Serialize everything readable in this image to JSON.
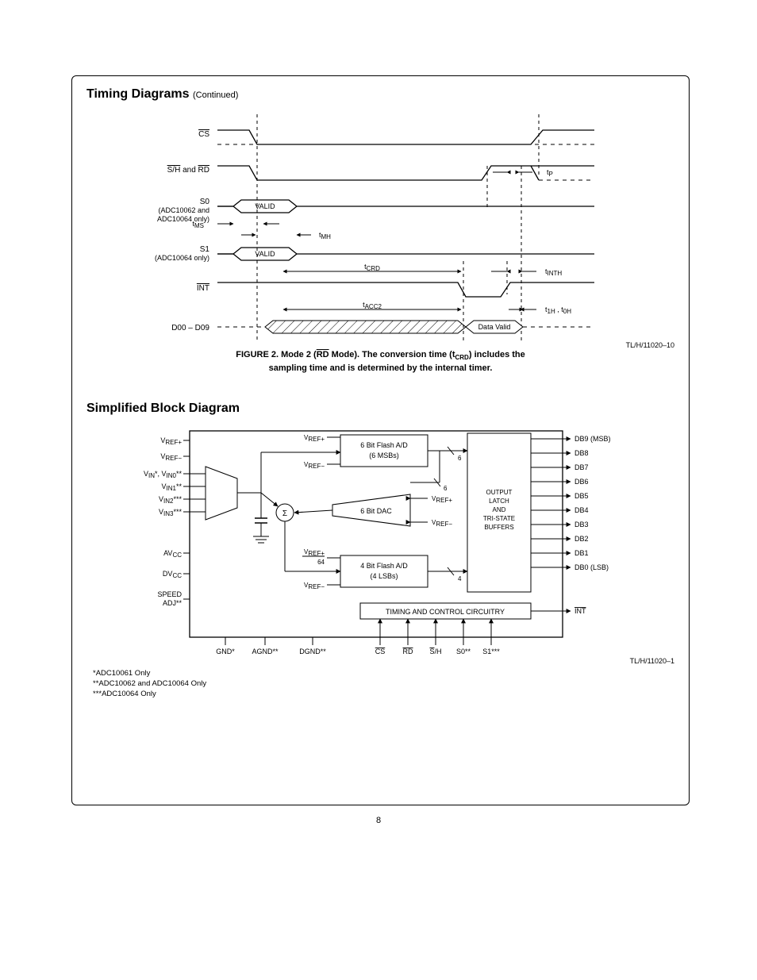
{
  "page_number": "8",
  "timing": {
    "header_main": "Timing Diagrams",
    "header_cont": "(Continued)",
    "signals": {
      "cs": "CS",
      "sh_and_rd_pre": "S/H",
      "sh_and_rd_mid": " and ",
      "sh_and_rd_post": "RD",
      "s0_line1": "S0",
      "s0_line2": "(ADC10062 and",
      "s0_line3": "ADC10064 only)",
      "s1_line1": "S1",
      "s1_line2": "(ADC10064 only)",
      "int": "INT",
      "data": "D00 – D09"
    },
    "markers": {
      "valid": "VALID",
      "tp": "tP",
      "tms": "tMS",
      "tmh": "tMH",
      "tcrd": "tCRD",
      "tinth": "tINTH",
      "tacc2": "tACC2",
      "t1h_t0h": "t1H , t0H",
      "data_valid": "Data Valid"
    },
    "tl_id": "TL/H/11020–10",
    "caption_l1_a": "FIGURE 2. Mode 2 (",
    "caption_l1_b": "RD",
    "caption_l1_c": " Mode). The conversion time (t",
    "caption_l1_d": "CRD",
    "caption_l1_e": ") includes the",
    "caption_l2": "sampling time and is determined by the internal timer."
  },
  "block": {
    "header": "Simplified Block Diagram",
    "left_pins": {
      "vrefp": "VREF+",
      "vrefm": "VREF−",
      "vin": "VIN*, VIN0**",
      "vin1": "VIN1**",
      "vin2": "VIN2***",
      "vin3": "VIN3***",
      "avcc": "AVCC",
      "dvcc": "DVCC",
      "speed1": "SPEED",
      "speed2": "ADJ**"
    },
    "internal": {
      "vrefp": "VREF+",
      "vrefm": "VREF−",
      "vrefp64_top": "VREF+",
      "vrefp64_bot": "64",
      "flash6_l1": "6 Bit Flash A/D",
      "flash6_l2": "(6 MSBs)",
      "dac6": "6 Bit DAC",
      "flash4_l1": "4 Bit Flash A/D",
      "flash4_l2": "(4 LSBs)",
      "sigma": "Σ",
      "output_l1": "OUTPUT",
      "output_l2": "LATCH",
      "output_l3": "AND",
      "output_l4": "TRI-STATE",
      "output_l5": "BUFFERS",
      "timing_ctrl": "TIMING AND CONTROL CIRCUITRY",
      "bus6": "6",
      "bus4": "4"
    },
    "right_pins": {
      "db9": "DB9 (MSB)",
      "db8": "DB8",
      "db7": "DB7",
      "db6": "DB6",
      "db5": "DB5",
      "db4": "DB4",
      "db3": "DB3",
      "db2": "DB2",
      "db1": "DB1",
      "db0": "DB0 (LSB)",
      "int": "INT"
    },
    "bottom_pins": {
      "gnd": "GND*",
      "agnd": "AGND**",
      "dgnd": "DGND**",
      "cs": "CS",
      "rd": "RD",
      "sh": "S/H",
      "s0": "S0**",
      "s1": "S1***"
    },
    "tl_id": "TL/H/11020–1",
    "footnote1": "*ADC10061 Only",
    "footnote2": "**ADC10062 and ADC10064 Only",
    "footnote3": "***ADC10064 Only"
  }
}
